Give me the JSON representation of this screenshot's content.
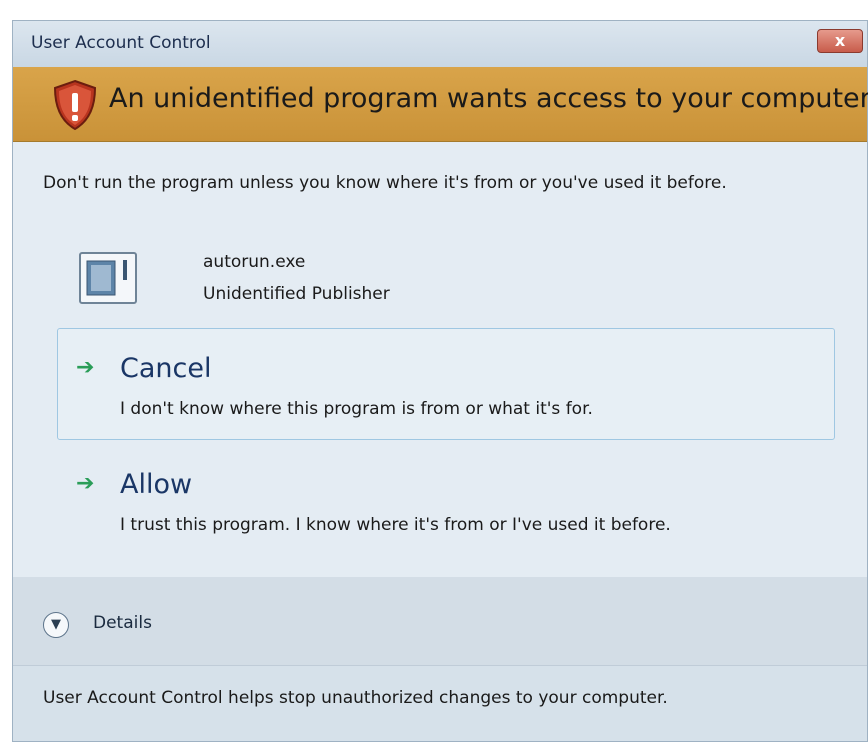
{
  "window": {
    "title": "User Account Control",
    "close_label": "x"
  },
  "banner": {
    "text": "An unidentified program wants access to your computer",
    "icon": "warning-shield-icon"
  },
  "message": {
    "warning": "Don't run the program unless you know where it's from or you've used it before."
  },
  "program": {
    "icon": "application-icon",
    "name": "autorun.exe",
    "publisher": "Unidentified Publisher"
  },
  "options": [
    {
      "icon": "green-arrow-icon",
      "title": "Cancel",
      "description": "I don't know where this program is from or what it's for."
    },
    {
      "icon": "green-arrow-icon",
      "title": "Allow",
      "description": "I trust this program. I know where it's from or I've used it before."
    }
  ],
  "details": {
    "icon": "chevron-down-icon",
    "label": "Details"
  },
  "footer": {
    "text": "User Account Control helps stop unauthorized changes to your computer."
  },
  "colors": {
    "banner": "#d9a44a",
    "content": "#e4ecf3",
    "arrow": "#2a9d58",
    "close": "#c85c4b"
  }
}
